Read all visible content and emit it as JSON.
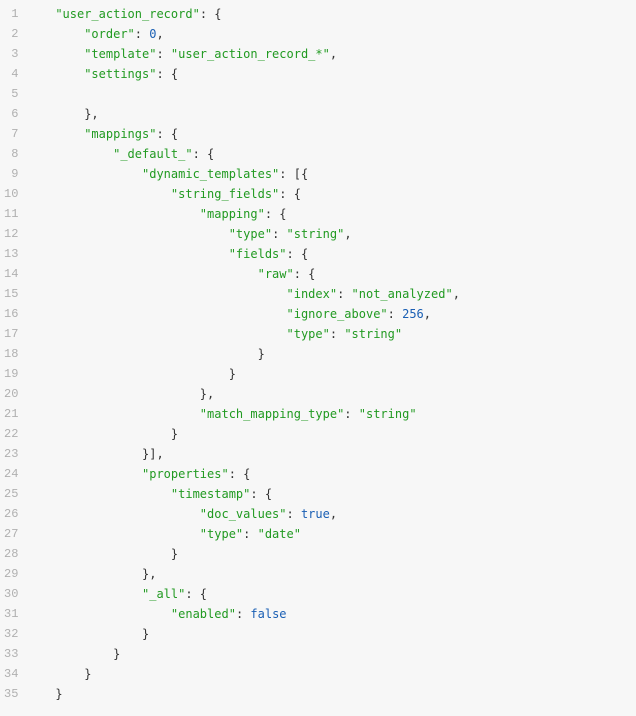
{
  "lines": [
    [
      {
        "t": "str",
        "v": "\"user_action_record\""
      },
      {
        "t": "p",
        "v": ": {"
      }
    ],
    [
      {
        "t": "str",
        "v": "\"order\""
      },
      {
        "t": "p",
        "v": ": "
      },
      {
        "t": "num",
        "v": "0"
      },
      {
        "t": "p",
        "v": ","
      }
    ],
    [
      {
        "t": "str",
        "v": "\"template\""
      },
      {
        "t": "p",
        "v": ": "
      },
      {
        "t": "str",
        "v": "\"user_action_record_*\""
      },
      {
        "t": "p",
        "v": ","
      }
    ],
    [
      {
        "t": "str",
        "v": "\"settings\""
      },
      {
        "t": "p",
        "v": ": {"
      }
    ],
    [],
    [
      {
        "t": "p",
        "v": "},"
      }
    ],
    [
      {
        "t": "str",
        "v": "\"mappings\""
      },
      {
        "t": "p",
        "v": ": {"
      }
    ],
    [
      {
        "t": "str",
        "v": "\"_default_\""
      },
      {
        "t": "p",
        "v": ": {"
      }
    ],
    [
      {
        "t": "str",
        "v": "\"dynamic_templates\""
      },
      {
        "t": "p",
        "v": ": [{"
      }
    ],
    [
      {
        "t": "str",
        "v": "\"string_fields\""
      },
      {
        "t": "p",
        "v": ": {"
      }
    ],
    [
      {
        "t": "str",
        "v": "\"mapping\""
      },
      {
        "t": "p",
        "v": ": {"
      }
    ],
    [
      {
        "t": "str",
        "v": "\"type\""
      },
      {
        "t": "p",
        "v": ": "
      },
      {
        "t": "str",
        "v": "\"string\""
      },
      {
        "t": "p",
        "v": ","
      }
    ],
    [
      {
        "t": "str",
        "v": "\"fields\""
      },
      {
        "t": "p",
        "v": ": {"
      }
    ],
    [
      {
        "t": "str",
        "v": "\"raw\""
      },
      {
        "t": "p",
        "v": ": {"
      }
    ],
    [
      {
        "t": "str",
        "v": "\"index\""
      },
      {
        "t": "p",
        "v": ": "
      },
      {
        "t": "str",
        "v": "\"not_analyzed\""
      },
      {
        "t": "p",
        "v": ","
      }
    ],
    [
      {
        "t": "str",
        "v": "\"ignore_above\""
      },
      {
        "t": "p",
        "v": ": "
      },
      {
        "t": "num",
        "v": "256"
      },
      {
        "t": "p",
        "v": ","
      }
    ],
    [
      {
        "t": "str",
        "v": "\"type\""
      },
      {
        "t": "p",
        "v": ": "
      },
      {
        "t": "str",
        "v": "\"string\""
      }
    ],
    [
      {
        "t": "p",
        "v": "}"
      }
    ],
    [
      {
        "t": "p",
        "v": "}"
      }
    ],
    [
      {
        "t": "p",
        "v": "},"
      }
    ],
    [
      {
        "t": "str",
        "v": "\"match_mapping_type\""
      },
      {
        "t": "p",
        "v": ": "
      },
      {
        "t": "str",
        "v": "\"string\""
      }
    ],
    [
      {
        "t": "p",
        "v": "}"
      }
    ],
    [
      {
        "t": "p",
        "v": "}],"
      }
    ],
    [
      {
        "t": "str",
        "v": "\"properties\""
      },
      {
        "t": "p",
        "v": ": {"
      }
    ],
    [
      {
        "t": "str",
        "v": "\"timestamp\""
      },
      {
        "t": "p",
        "v": ": {"
      }
    ],
    [
      {
        "t": "str",
        "v": "\"doc_values\""
      },
      {
        "t": "p",
        "v": ": "
      },
      {
        "t": "kw",
        "v": "true"
      },
      {
        "t": "p",
        "v": ","
      }
    ],
    [
      {
        "t": "str",
        "v": "\"type\""
      },
      {
        "t": "p",
        "v": ": "
      },
      {
        "t": "str",
        "v": "\"date\""
      }
    ],
    [
      {
        "t": "p",
        "v": "}"
      }
    ],
    [
      {
        "t": "p",
        "v": "},"
      }
    ],
    [
      {
        "t": "str",
        "v": "\"_all\""
      },
      {
        "t": "p",
        "v": ": {"
      }
    ],
    [
      {
        "t": "str",
        "v": "\"enabled\""
      },
      {
        "t": "p",
        "v": ": "
      },
      {
        "t": "kw",
        "v": "false"
      }
    ],
    [
      {
        "t": "p",
        "v": "}"
      }
    ],
    [
      {
        "t": "p",
        "v": "}"
      }
    ],
    [
      {
        "t": "p",
        "v": "}"
      }
    ],
    [
      {
        "t": "p",
        "v": "}"
      }
    ]
  ],
  "indents": [
    1,
    2,
    2,
    2,
    0,
    2,
    2,
    3,
    4,
    5,
    6,
    7,
    7,
    8,
    9,
    9,
    9,
    8,
    7,
    6,
    6,
    5,
    4,
    4,
    5,
    6,
    6,
    5,
    4,
    4,
    5,
    4,
    3,
    2,
    1
  ]
}
